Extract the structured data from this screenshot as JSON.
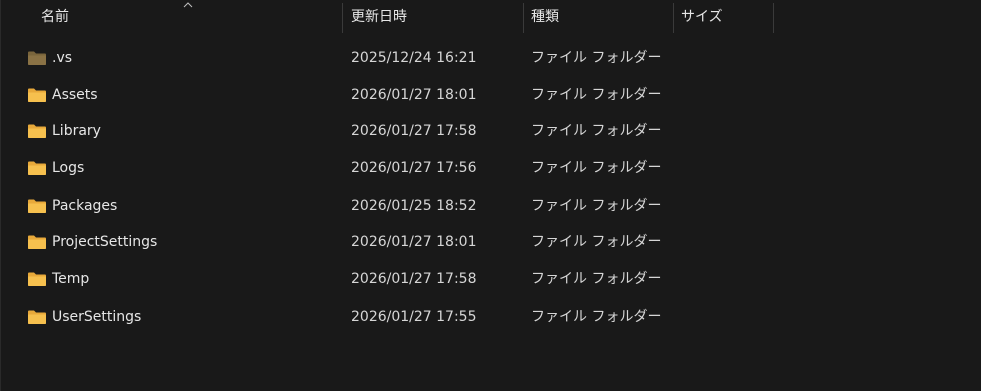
{
  "columns": {
    "name": "名前",
    "modified": "更新日時",
    "type": "種類",
    "size": "サイズ"
  },
  "colors": {
    "background": "#191919",
    "folder_yellow": "#f6c04e",
    "folder_hidden": "#8a7245",
    "text": "#e6e6e6"
  },
  "sort_indicator": "chevron-up-icon",
  "files": [
    {
      "name": ".vs",
      "modified": "2025/12/24 16:21",
      "type": "ファイル フォルダー",
      "size": "",
      "icon": "folder-hidden-icon"
    },
    {
      "name": "Assets",
      "modified": "2026/01/27 18:01",
      "type": "ファイル フォルダー",
      "size": "",
      "icon": "folder-icon"
    },
    {
      "name": "Library",
      "modified": "2026/01/27 17:58",
      "type": "ファイル フォルダー",
      "size": "",
      "icon": "folder-icon"
    },
    {
      "name": "Logs",
      "modified": "2026/01/27 17:56",
      "type": "ファイル フォルダー",
      "size": "",
      "icon": "folder-icon"
    },
    {
      "name": "Packages",
      "modified": "2026/01/25 18:52",
      "type": "ファイル フォルダー",
      "size": "",
      "icon": "folder-icon"
    },
    {
      "name": "ProjectSettings",
      "modified": "2026/01/27 18:01",
      "type": "ファイル フォルダー",
      "size": "",
      "icon": "folder-icon"
    },
    {
      "name": "Temp",
      "modified": "2026/01/27 17:58",
      "type": "ファイル フォルダー",
      "size": "",
      "icon": "folder-icon"
    },
    {
      "name": "UserSettings",
      "modified": "2026/01/27 17:55",
      "type": "ファイル フォルダー",
      "size": "",
      "icon": "folder-icon"
    }
  ]
}
